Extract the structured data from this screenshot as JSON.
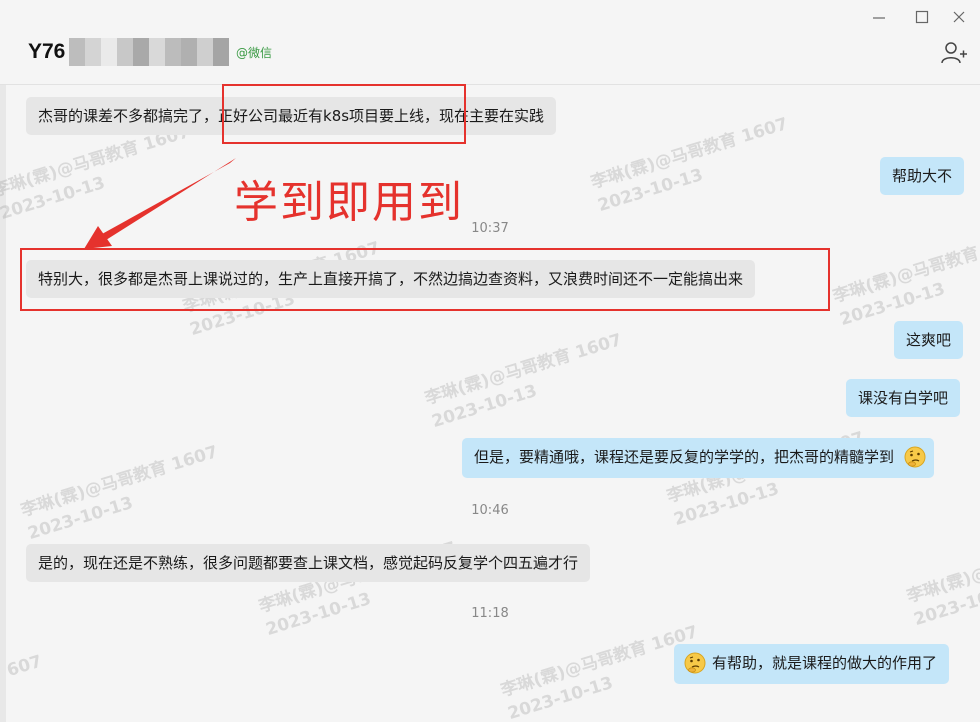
{
  "window": {
    "controls": {
      "minimize": "—",
      "maximize": "☐",
      "close": "✕"
    }
  },
  "header": {
    "name_visible": "Y76",
    "wechat_tag": "@微信",
    "add_member_icon": "add-person-icon"
  },
  "messages": [
    {
      "side": "in",
      "text": "杰哥的课差不多都搞完了，正好公司最近有k8s项目要上线，现在主要在实践"
    },
    {
      "side": "out",
      "text": "帮助大不"
    },
    {
      "type": "time",
      "text": "10:37"
    },
    {
      "side": "in",
      "text": "特别大，很多都是杰哥上课说过的，生产上直接开搞了，不然边搞边查资料，又浪费时间还不一定能搞出来"
    },
    {
      "side": "out",
      "text": "这爽吧"
    },
    {
      "side": "out",
      "text": "课没有白学吧"
    },
    {
      "side": "out",
      "text": "但是，要精通哦，课程还是要反复的学学的，把杰哥的精髓学到",
      "emoji": "thinking-face-emoji"
    },
    {
      "type": "time",
      "text": "10:46"
    },
    {
      "side": "in",
      "text": "是的，现在还是不熟练，很多问题都要查上课文档，感觉起码反复学个四五遍才行"
    },
    {
      "type": "time",
      "text": "11:18"
    },
    {
      "side": "out",
      "text": "有帮助，就是课程的做大的作用了",
      "emoji_before": "thinking-face-emoji"
    }
  ],
  "annotation": {
    "caption": "学到即用到",
    "color": "#e5322d"
  },
  "watermark": {
    "line1": "李琳(霖)@马哥教育 1607",
    "line2": "2023-10-13",
    "partial_line1": "607"
  },
  "colors": {
    "incoming_bubble": "#e6e6e6",
    "outgoing_bubble": "#c4e6f9",
    "wechat_green": "#3a9a44",
    "annotation_red": "#e5322d"
  }
}
